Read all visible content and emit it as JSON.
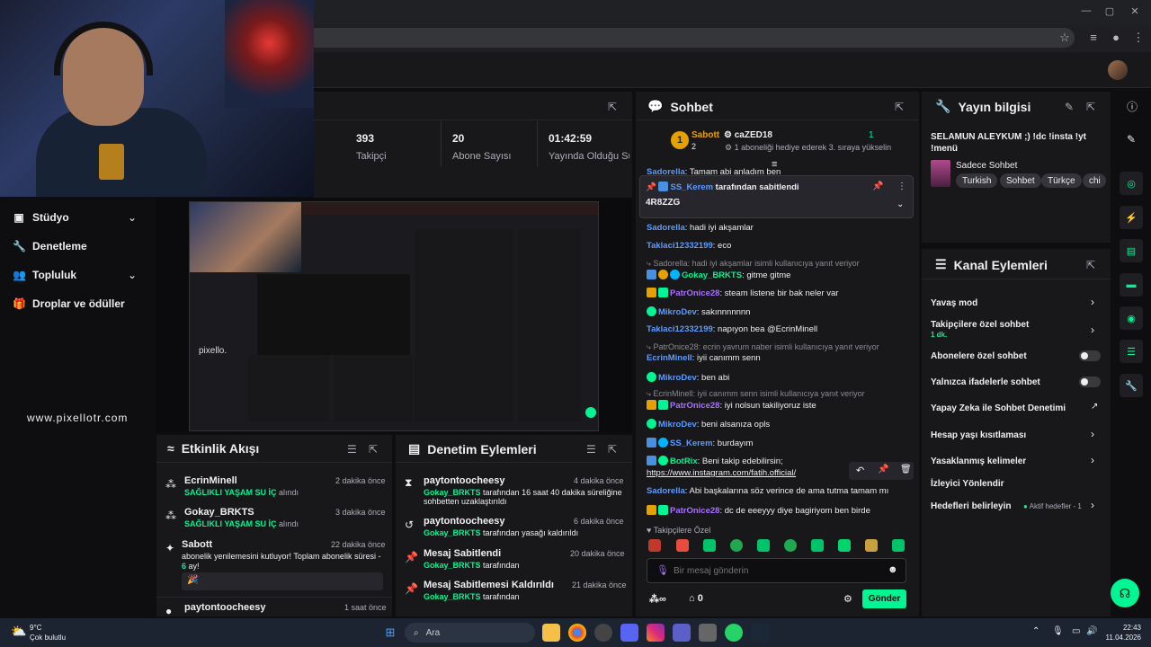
{
  "browser": {
    "window_controls": [
      "—",
      "▢",
      "✕"
    ]
  },
  "left_nav": {
    "items": [
      {
        "label": "Stüdyo",
        "icon": "studio-icon"
      },
      {
        "label": "Denetleme",
        "icon": "wrench-icon"
      },
      {
        "label": "Topluluk",
        "icon": "community-icon"
      },
      {
        "label": "Droplar ve ödüller",
        "icon": "gift-icon"
      }
    ],
    "watermark": "www.pixellotr.com"
  },
  "stats": {
    "followers_value": "393",
    "followers_label": "Takipçi",
    "subs_value": "20",
    "subs_label": "Abone Sayısı",
    "uptime_value": "01:42:59",
    "uptime_label": "Yayında Olduğu Süre"
  },
  "activity_feed": {
    "title": "Etkinlik Akışı",
    "items": [
      {
        "name": "EcrinMinell",
        "time": "2 dakika önce",
        "highlight": "SAĞLIKLI YAŞAM SU İÇ",
        "suffix": " alındı"
      },
      {
        "name": "Gokay_BRKTS",
        "time": "3 dakika önce",
        "highlight": "SAĞLIKLI YAŞAM SU İÇ",
        "suffix": " alındı"
      },
      {
        "name": "Sabott",
        "time": "22 dakika önce",
        "text": "abonelik yenilemesini kutluyor! Toplam abonelik süresi - ",
        "highlight": "6",
        "suffix": " ay!"
      },
      {
        "name": "paytontoocheesy",
        "time": "1 saat önce"
      }
    ]
  },
  "mod_actions": {
    "title": "Denetim Eylemleri",
    "items": [
      {
        "title": "paytontoocheesy",
        "time": "4 dakika önce",
        "actor": "Gokay_BRKTS",
        "text": " tarafından 16 saat 40 dakika süreliğine sohbetten uzaklaştırıldı"
      },
      {
        "title": "paytontoocheesy",
        "time": "6 dakika önce",
        "actor": "Gokay_BRKTS",
        "text": " tarafından yasağı kaldırıldı"
      },
      {
        "title": "Mesaj Sabitlendi",
        "time": "20 dakika önce",
        "actor": "Gokay_BRKTS",
        "text": " tarafından"
      },
      {
        "title": "Mesaj Sabitlemesi Kaldırıldı",
        "time": "21 dakika önce",
        "actor": "Gokay_BRKTS",
        "text": " tarafından"
      }
    ]
  },
  "chat": {
    "title": "Sohbet",
    "leader_name": "Sabott",
    "leader_count": "2",
    "gift_name": "caZED18",
    "gift_count": "1",
    "gift_text": "1 aboneliği hediye ederek 3. sıraya yükselin",
    "pinned_by": "SS_Kerem",
    "pinned_suffix": " tarafından sabitlendi",
    "pinned_message": "4R8ZZG",
    "cut_line_user": "Sadorella",
    "cut_line_text": ": Tamam abi anladım ben",
    "messages": [
      {
        "user": "Sadorella",
        "color": "#5c9bff",
        "text": ": hadi iyi akşamlar"
      },
      {
        "user": "Taklaci12332199",
        "color": "#5c9bff",
        "text": ": eco"
      },
      {
        "reply": "Sadorella: hadi iyi akşamlar isimli kullanıcıya yanıt veriyor"
      },
      {
        "user": "Gokay_BRKTS",
        "color": "#00f593",
        "text": ": gitme gitme"
      },
      {
        "user": "PatrOnice28",
        "color": "#a970ff",
        "text": ": steam listene bir bak neler var"
      },
      {
        "user": "MikroDev",
        "color": "#5c9bff",
        "text": ": sakınnnnnnn"
      },
      {
        "user": "Taklaci12332199",
        "color": "#5c9bff",
        "text": ": napıyon bea @EcrinMinell"
      },
      {
        "reply": "PatrOnice28: ecrin yavrum naber isimli kullanıcıya yanıt veriyor"
      },
      {
        "user": "EcrinMinell",
        "color": "#5c9bff",
        "text": ": iyii canımm senn"
      },
      {
        "user": "MikroDev",
        "color": "#5c9bff",
        "text": ": ben abi"
      },
      {
        "reply": "EcrinMinell: iyii canımm senn isimli kullanıcıya yanıt veriyor"
      },
      {
        "user": "PatrOnice28",
        "color": "#a970ff",
        "text": ": iyi nolsun takiliyoruz iste"
      },
      {
        "user": "MikroDev",
        "color": "#5c9bff",
        "text": ": beni alsanıza opls"
      },
      {
        "user": "SS_Kerem",
        "color": "#5c9bff",
        "text": ": burdayım"
      },
      {
        "user": "BotRix",
        "color": "#00f593",
        "text": ": Beni takip edebilirsin;"
      },
      {
        "link": "https://www.instagram.com/fatih.official/"
      },
      {
        "user": "Sadorella",
        "color": "#5c9bff",
        "text": ": Abi başkalarına söz verince de ama tutma tamam mı"
      },
      {
        "user": "PatrOnice28",
        "color": "#a970ff",
        "text": ": dc de eeeyyy diye bagiriyom ben birde"
      }
    ],
    "follower_only_label": "Takipçilere Özel",
    "input_placeholder": "Bir mesaj gönderin",
    "infinity_label": "∞",
    "points_value": "0",
    "send_label": "Gönder"
  },
  "stream_info": {
    "title": "Yayın bilgisi",
    "stream_title": "SELAMUN ALEYKUM ;) !dc !insta !yt !menü",
    "category": "Sadece Sohbet",
    "tags": [
      "Turkish",
      "Sohbet",
      "Türkçe",
      "chi"
    ]
  },
  "channel_actions": {
    "title": "Kanal Eylemleri",
    "items": [
      {
        "label": "Yavaş mod",
        "type": "chevron"
      },
      {
        "label": "Takipçilere özel sohbet",
        "sub": "1 dk.",
        "type": "chevron"
      },
      {
        "label": "Abonelere özel sohbet",
        "type": "toggle"
      },
      {
        "label": "Yalnızca ifadelerle sohbet",
        "type": "toggle"
      },
      {
        "label": "Yapay Zeka ile Sohbet Denetimi",
        "type": "external"
      },
      {
        "label": "Hesap yaşı kısıtlaması",
        "type": "chevron"
      },
      {
        "label": "Yasaklanmış kelimeler",
        "type": "chevron"
      },
      {
        "label": "İzleyici Yönlendir",
        "type": "none"
      },
      {
        "label": "Hedefleri belirleyin",
        "sub": "Aktif hedefler - 1",
        "type": "chevron"
      }
    ]
  },
  "taskbar": {
    "weather_temp": "9°C",
    "weather_desc": "Çok bulutlu",
    "search_label": "Ara",
    "time": "22:43",
    "date": "11.04.2026"
  },
  "colors": {
    "accent": "#00f593",
    "bg": "#0e0e10",
    "panel": "#18181b"
  }
}
